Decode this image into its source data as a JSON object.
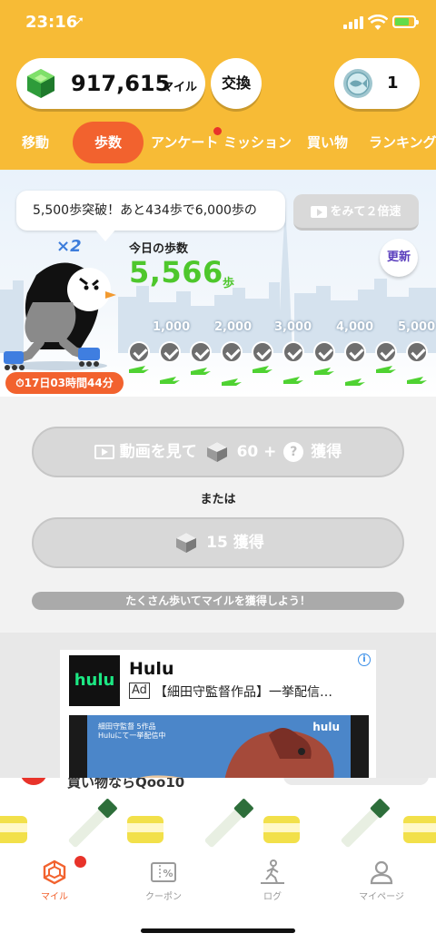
{
  "status_bar": {
    "time": "23:16"
  },
  "header": {
    "miles": "917,615",
    "mile_unit": "マイル",
    "exchange_label": "交換",
    "ticket_count": "1"
  },
  "tabs": [
    {
      "label": "移動"
    },
    {
      "label": "歩数"
    },
    {
      "label": "アンケート"
    },
    {
      "label": "ミッション"
    },
    {
      "label": "買い物"
    },
    {
      "label": "ランキング"
    }
  ],
  "steps": {
    "message": "5,500歩突破！あと434歩で6,000歩の",
    "double_label": "をみて２倍速",
    "today_label": "今日の歩数",
    "count": "5,566",
    "unit": "歩",
    "refresh_label": "更新",
    "multiplier": "×2",
    "timer": "17日03時間44分",
    "milestones": [
      "1,000",
      "2,000",
      "3,000",
      "4,000",
      "5,000"
    ],
    "completed_checks": 10
  },
  "earn": {
    "video_label": "動画を見て",
    "video_amount": "60 +",
    "video_q": "?",
    "video_suffix": "獲得",
    "or_label": "または",
    "plain_amount": "15 獲得",
    "hint": "たくさん歩いてマイルを獲得しよう！"
  },
  "ad": {
    "logo": "hulu",
    "brand": "Hulu",
    "badge": "Ad",
    "desc": "【細田守監督作品】一挙配信…",
    "video_text_1": "細田守監督 5作品",
    "video_text_2": "Huluにて一挙配信中",
    "video_logo": "hulu"
  },
  "banner": {
    "title": "買い物ならQoo10"
  },
  "bottom_nav": [
    {
      "label": "マイル"
    },
    {
      "label": "クーポン"
    },
    {
      "label": "ログ"
    },
    {
      "label": "マイページ"
    }
  ],
  "colors": {
    "header_bg": "#f7bb36",
    "accent": "#f2622e",
    "steps_green": "#4ec72c",
    "badge_red": "#e8332a"
  }
}
